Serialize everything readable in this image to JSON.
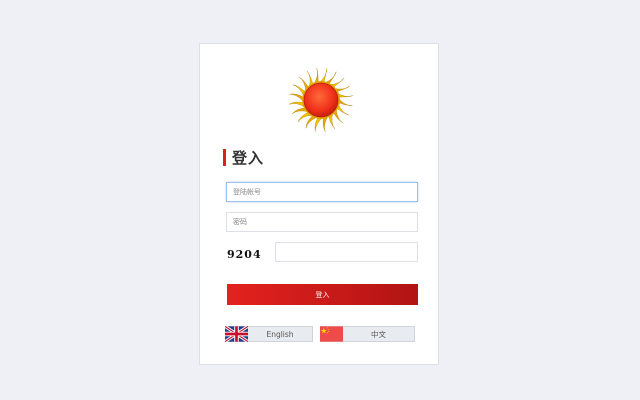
{
  "login": {
    "title": "登入",
    "account_placeholder": "登陆帐号",
    "password_placeholder": "密码",
    "captcha_text": "9204",
    "captcha_value": "",
    "submit_label": "登入"
  },
  "languages": [
    {
      "label": "English",
      "flag": "uk-flag-icon"
    },
    {
      "label": "中文",
      "flag": "china-flag-icon"
    }
  ],
  "colors": {
    "accent": "#d9241c",
    "button_start": "#e3221e",
    "button_end": "#b11414",
    "background": "#eef0f5"
  }
}
